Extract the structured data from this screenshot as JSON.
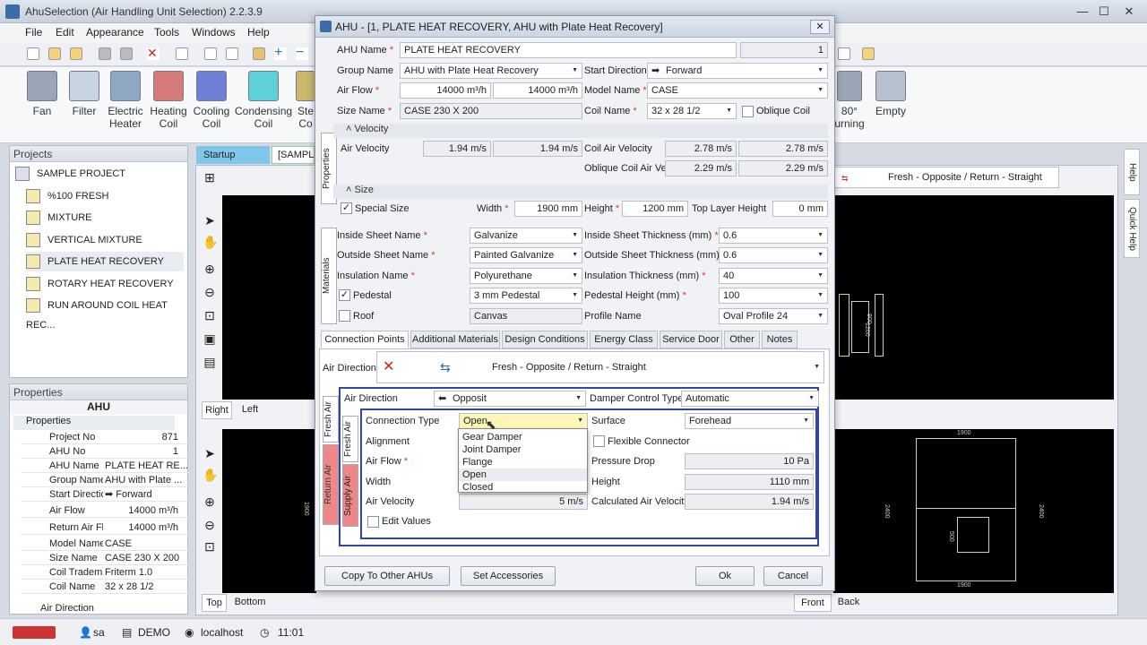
{
  "window": {
    "title": "AhuSelection (Air Handling Unit Selection) 2.2.3.9"
  },
  "menu": [
    "File",
    "Edit",
    "Appearance",
    "Tools",
    "Windows",
    "Help"
  ],
  "ribbon": [
    {
      "label": "Fan",
      "color": "#9aa6b5"
    },
    {
      "label": "Filter",
      "color": "#c8d4e0"
    },
    {
      "label": "Electric Heater",
      "color": "#8fa7c4"
    },
    {
      "label": "Heating Coil",
      "color": "#d47a7a"
    },
    {
      "label": "Cooling Coil",
      "color": "#6f7fd6"
    },
    {
      "label": "Condensing Coil",
      "color": "#5fd0d8"
    },
    {
      "label": "Ste Co",
      "color": "#c9b96a"
    }
  ],
  "ribbon_right": [
    {
      "label": "80° urning"
    },
    {
      "label": "Empty"
    }
  ],
  "projects": {
    "title": "Projects",
    "root": "SAMPLE PROJECT",
    "items": [
      "%100 FRESH",
      "MIXTURE",
      "VERTICAL MIXTURE",
      "PLATE HEAT RECOVERY",
      "ROTARY HEAT RECOVERY",
      "RUN AROUND COIL HEAT REC..."
    ]
  },
  "properties": {
    "title": "Properties",
    "header": "AHU",
    "group": "Properties",
    "rows": [
      [
        "Project No",
        "871"
      ],
      [
        "AHU No",
        "1"
      ],
      [
        "AHU Name",
        "PLATE HEAT RE..."
      ],
      [
        "Group Name",
        "AHU with Plate ..."
      ],
      [
        "Start Directio",
        "Forward"
      ],
      [
        "Air Flow",
        "14000  m³/h"
      ],
      [
        "Return Air Fl",
        "14000  m³/h"
      ],
      [
        "Model Name",
        "CASE"
      ],
      [
        "Size Name",
        "CASE 230 X 200"
      ],
      [
        "Coil Tradema",
        "Friterm 1.0"
      ],
      [
        "Coil Name",
        "32 x 28 1/2"
      ]
    ],
    "footer": "Air Direction"
  },
  "doc_tabs": {
    "startup": "Startup",
    "sample": "[SAMPLE"
  },
  "view_tabs": {
    "right": "Right",
    "left": "Left",
    "top": "Top",
    "bottom": "Bottom",
    "front": "Front",
    "back": "Back"
  },
  "right_dropdown": "Fresh - Opposite / Return - Straight",
  "side_tabs": {
    "help": "Help",
    "quick": "Quick Help"
  },
  "dialog": {
    "title": "AHU - [1, PLATE HEAT RECOVERY, AHU with Plate Heat Recovery]",
    "ahu_name_label": "AHU Name",
    "ahu_name": "PLATE HEAT RECOVERY",
    "ahu_no": "1",
    "group_label": "Group Name",
    "group": "AHU with Plate Heat Recovery",
    "start_dir_label": "Start Direction",
    "start_dir": "Forward",
    "airflow_label": "Air Flow",
    "airflow1": "14000  m³/h",
    "airflow2": "14000  m³/h",
    "model_label": "Model Name",
    "model": "CASE",
    "size_label": "Size Name",
    "size": "CASE 230 X 200",
    "coil_label": "Coil Name",
    "coil": "32 x 28 1/2",
    "oblique": "Oblique Coil",
    "velocity_section": "Velocity",
    "air_vel_label": "Air Velocity",
    "air_vel1": "1.94  m/s",
    "air_vel2": "1.94  m/s",
    "coil_vel_label": "Coil Air Velocity",
    "coil_vel1": "2.78  m/s",
    "coil_vel2": "2.78  m/s",
    "oblique_vel_label": "Oblique Coil Air Vel.",
    "oblique_vel1": "2.29  m/s",
    "oblique_vel2": "2.29  m/s",
    "size_section": "Size",
    "special_size": "Special Size",
    "width_label": "Width",
    "width": "1900  mm",
    "height_label": "Height",
    "height": "1200  mm",
    "top_layer_label": "Top Layer Height",
    "top_layer": "0  mm",
    "properties_vtab": "Properties",
    "materials_vtab": "Materials",
    "inside_sheet_label": "Inside Sheet Name",
    "inside_sheet": "Galvanize",
    "inside_thk_label": "Inside Sheet Thickness (mm)",
    "inside_thk": "0.6",
    "outside_sheet_label": "Outside Sheet Name",
    "outside_sheet": "Painted Galvanize",
    "outside_thk_label": "Outside Sheet Thickness (mm)",
    "outside_thk": "0.6",
    "insulation_label": "Insulation Name",
    "insulation": "Polyurethane",
    "insulation_thk_label": "Insulation Thickness (mm)",
    "insulation_thk": "40",
    "pedestal_label": "Pedestal",
    "pedestal": "3 mm Pedestal",
    "pedestal_h_label": "Pedestal Height (mm)",
    "pedestal_h": "100",
    "roof_label": "Roof",
    "roof": "Canvas",
    "profile_label": "Profile Name",
    "profile": "Oval Profile 24",
    "tabs": [
      "Connection Points",
      "Additional Materials",
      "Design Conditions",
      "Energy Class",
      "Service Door",
      "Other",
      "Notes"
    ],
    "air_direction_label": "Air Direction",
    "air_direction": "Fresh - Opposite / Return - Straight",
    "inner_air_dir_label": "Air Direction",
    "inner_air_dir": "Opposit",
    "damper_label": "Damper Control Type",
    "damper": "Automatic",
    "fresh_air": "Fresh Air",
    "return_air": "Return Air",
    "supply_air": "Supply Air",
    "conn_type_label": "Connection Type",
    "conn_type": "Open",
    "surface_label": "Surface",
    "surface": "Forehead",
    "alignment_label": "Alignment",
    "flexible": "Flexible Connector",
    "airflow_in_label": "Air Flow",
    "pressure_label": "Pressure Drop",
    "pressure": "10  Pa",
    "width_in_label": "Width",
    "height_in_label": "Height",
    "height_in": "1110  mm",
    "air_vel_in_label": "Air Velocity",
    "air_vel_in": "5  m/s",
    "calc_vel_label": "Calculated Air Velocity",
    "calc_vel": "1.94  m/s",
    "edit_values": "Edit Values",
    "options": [
      "Gear Damper",
      "Joint Damper",
      "Flange",
      "Open",
      "Closed"
    ],
    "buttons": {
      "copy": "Copy To Other AHUs",
      "accessories": "Set Accessories",
      "ok": "Ok",
      "cancel": "Cancel"
    }
  },
  "drawing_labels": {
    "top_w": "1900",
    "bottom_w": "1900",
    "side_h1": "2400",
    "side_h2": "2400",
    "small": "500",
    "mid": "1900",
    "right_h": "1900",
    "dim_small": "800",
    "dim_mid": "1200"
  },
  "statusbar": {
    "user": "sa",
    "db": "DEMO",
    "host": "localhost",
    "time": "11:01"
  }
}
